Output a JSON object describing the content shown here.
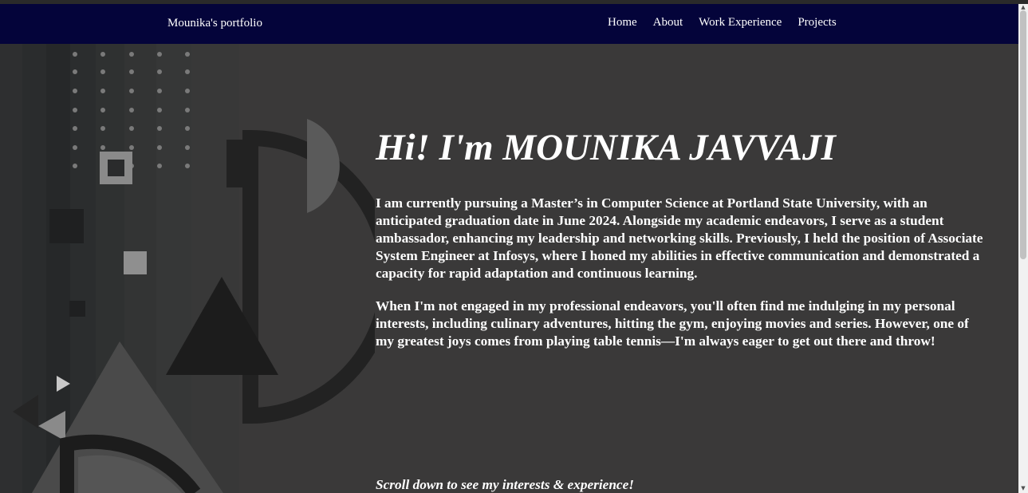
{
  "nav": {
    "brand": "Mounika's portfolio",
    "links": [
      {
        "label": "Home"
      },
      {
        "label": "About"
      },
      {
        "label": "Work Experience"
      },
      {
        "label": "Projects"
      }
    ],
    "background_color": "#04043a"
  },
  "hero": {
    "title": "Hi! I'm MOUNIKA JAVVAJI",
    "paragraphs": [
      "I am currently pursuing a Master’s in Computer Science at Portland State University, with an anticipated graduation date in June 2024. Alongside my academic endeavors, I serve as a student ambassador, enhancing my leadership and networking skills. Previously, I held the position of Associate System Engineer at Infosys, where I honed my abilities in effective communication and demonstrated a capacity for rapid adaptation and continuous learning.",
      "When I'm not engaged in my professional endeavors, you'll often find me indulging in my personal interests, including culinary adventures, hitting the gym, enjoying movies and series. However, one of my greatest joys comes from playing table tennis—I'm always eager to get out there and throw!"
    ],
    "scroll_hint": "Scroll down to see my interests & experience!"
  },
  "colors": {
    "page_background": "#3a3939",
    "text": "#ffffff"
  },
  "scrollbar": {
    "up_arrow_icon": "▲",
    "down_arrow_icon": "▼"
  }
}
